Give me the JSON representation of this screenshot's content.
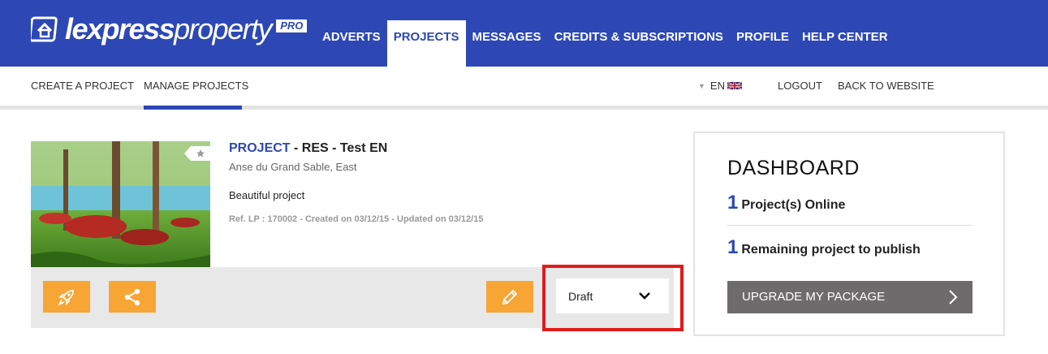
{
  "header": {
    "logo": {
      "brand_bold": "lexpress",
      "brand_thin": "property",
      "badge": "PRO"
    },
    "nav": [
      {
        "label": "ADVERTS",
        "active": false
      },
      {
        "label": "PROJECTS",
        "active": true
      },
      {
        "label": "MESSAGES",
        "active": false
      },
      {
        "label": "CREDITS & SUBSCRIPTIONS",
        "active": false
      },
      {
        "label": "PROFILE",
        "active": false
      },
      {
        "label": "HELP CENTER",
        "active": false
      }
    ],
    "accent_color": "#2d48b4"
  },
  "subnav": {
    "create_label": "CREATE A PROJECT",
    "manage_label": "MANAGE PROJECTS",
    "active": "MANAGE PROJECTS",
    "language": "EN",
    "language_flag": "uk-flag-icon",
    "logout_label": "LOGOUT",
    "back_label": "BACK TO WEBSITE"
  },
  "project": {
    "type_label": "PROJECT",
    "title_rest": " - RES - Test EN",
    "location": "Anse du Grand Sable, East",
    "description": "Beautiful project",
    "meta": "Ref. LP : 170002 - Created on 03/12/15 - Updated on 03/12/15",
    "status": "Draft",
    "actions": [
      {
        "name": "boost",
        "icon": "rocket-icon"
      },
      {
        "name": "share",
        "icon": "share-icon"
      },
      {
        "name": "edit",
        "icon": "pencil-icon"
      }
    ],
    "action_color": "#f7a535"
  },
  "dashboard": {
    "title": "DASHBOARD",
    "online_count": "1",
    "online_label": "Project(s) Online",
    "remaining_count": "1",
    "remaining_label": "Remaining project to publish",
    "upgrade_label": "UPGRADE MY PACKAGE"
  }
}
